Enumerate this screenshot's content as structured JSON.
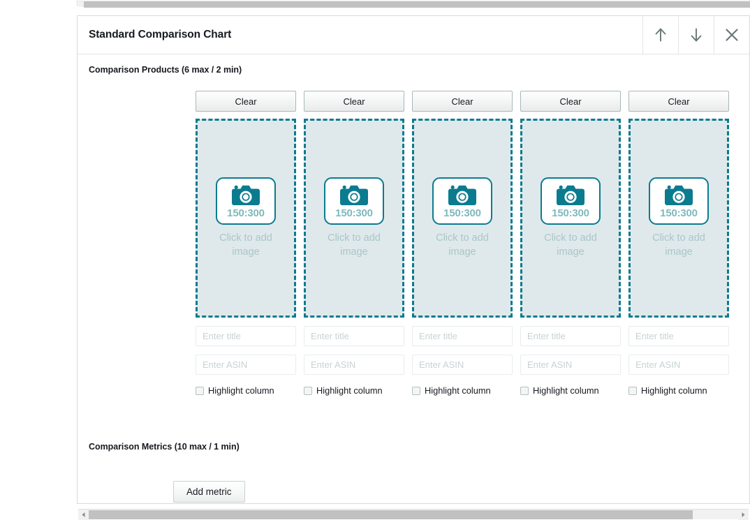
{
  "top_partial_panel": {
    "present": true
  },
  "card": {
    "header": {
      "title": "Standard Comparison Chart",
      "buttons": [
        {
          "name": "move-up",
          "icon": "arrow-up-icon",
          "label": ""
        },
        {
          "name": "move-down",
          "icon": "arrow-down-icon",
          "label": ""
        },
        {
          "name": "remove",
          "icon": "close-icon",
          "label": ""
        }
      ]
    },
    "products_section": {
      "label": "Comparison Products (6 max / 2 min)",
      "columns": [
        {
          "clear_label": "Clear",
          "dropzone": {
            "ratio": "150:300",
            "caption": "Click to add image",
            "icon": "camera-icon"
          },
          "title_placeholder": "Enter title",
          "title_value": "",
          "asin_placeholder": "Enter ASIN",
          "asin_value": "",
          "highlight_label": "Highlight column",
          "highlight_checked": false
        },
        {
          "clear_label": "Clear",
          "dropzone": {
            "ratio": "150:300",
            "caption": "Click to add image",
            "icon": "camera-icon"
          },
          "title_placeholder": "Enter title",
          "title_value": "",
          "asin_placeholder": "Enter ASIN",
          "asin_value": "",
          "highlight_label": "Highlight column",
          "highlight_checked": false
        },
        {
          "clear_label": "Clear",
          "dropzone": {
            "ratio": "150:300",
            "caption": "Click to add image",
            "icon": "camera-icon"
          },
          "title_placeholder": "Enter title",
          "title_value": "",
          "asin_placeholder": "Enter ASIN",
          "asin_value": "",
          "highlight_label": "Highlight column",
          "highlight_checked": false
        },
        {
          "clear_label": "Clear",
          "dropzone": {
            "ratio": "150:300",
            "caption": "Click to add image",
            "icon": "camera-icon"
          },
          "title_placeholder": "Enter title",
          "title_value": "",
          "asin_placeholder": "Enter ASIN",
          "asin_value": "",
          "highlight_label": "Highlight column",
          "highlight_checked": false
        },
        {
          "clear_label": "Clear",
          "dropzone": {
            "ratio": "150:300",
            "caption": "Click to add image",
            "icon": "camera-icon"
          },
          "title_placeholder": "Enter title",
          "title_value": "",
          "asin_placeholder": "Enter ASIN",
          "asin_value": "",
          "highlight_label": "Highlight column",
          "highlight_checked": false
        }
      ]
    },
    "metrics_section": {
      "label": "Comparison Metrics (10 max / 1 min)",
      "add_metric_label": "Add metric"
    }
  },
  "scrollbar": {
    "left_arrow": "scroll-left-icon",
    "right_arrow": "scroll-right-icon",
    "thumb_percent": 93
  },
  "colors": {
    "accent_teal": "#0b7b8f",
    "dropzone_fill": "#dfe9eb",
    "placeholder_text": "#c8d2d4",
    "caption_text": "#a9c6c8",
    "ratio_text": "#7fb9bd",
    "border": "#d5dbdb",
    "text": "#16191f"
  }
}
